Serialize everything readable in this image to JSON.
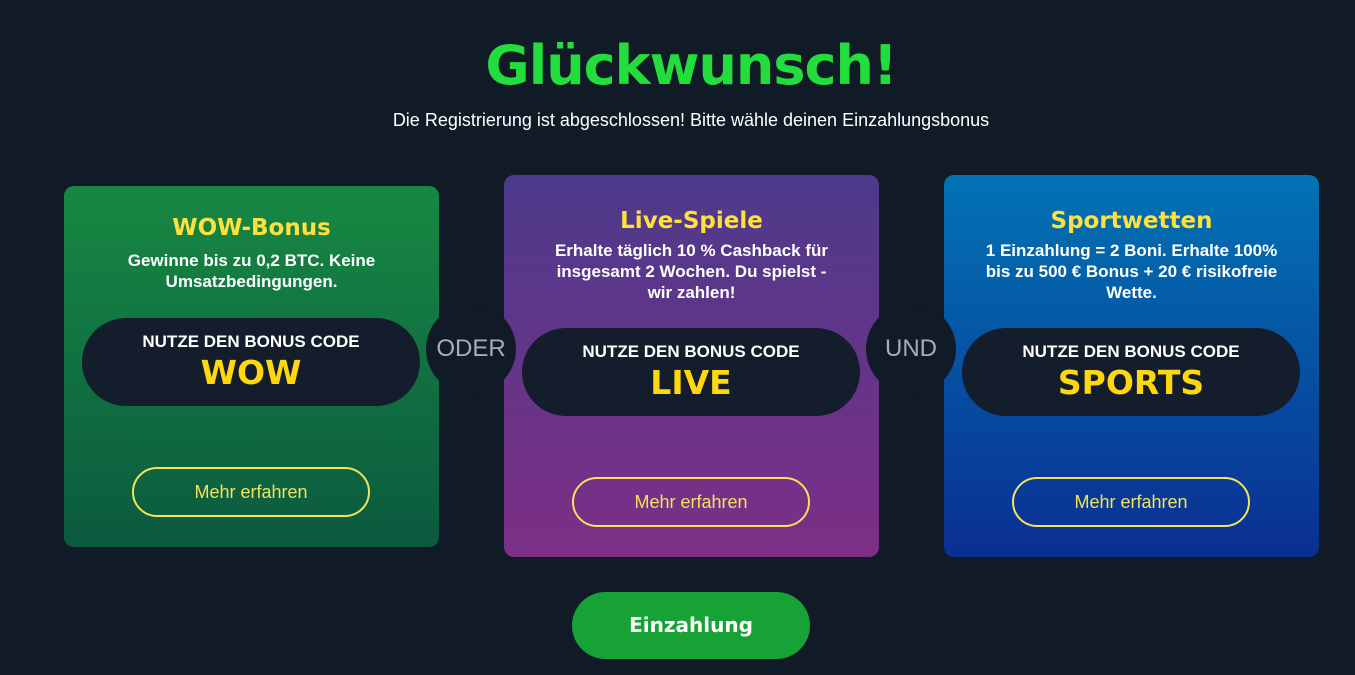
{
  "header": {
    "title": "Glückwunsch!",
    "subtitle": "Die Registrierung ist abgeschlossen! Bitte wähle deinen Einzahlungsbonus"
  },
  "cards": [
    {
      "title": "WOW-Bonus",
      "description": "Gewinne bis zu 0,2 BTC. Keine Umsatzbedingungen.",
      "code_label": "NUTZE DEN BONUS CODE",
      "code": "WOW",
      "button_label": "Mehr erfahren"
    },
    {
      "title": "Live-Spiele",
      "description": "Erhalte täglich 10 % Cashback für insgesamt 2 Wochen. Du spielst - wir zahlen!",
      "code_label": "NUTZE DEN BONUS CODE",
      "code": "LIVE",
      "button_label": "Mehr erfahren"
    },
    {
      "title": "Sportwetten",
      "description": "1 Einzahlung = 2 Boni. Erhalte 100% bis zu 500 € Bonus + 20 € risikofreie Wette.",
      "code_label": "NUTZE DEN BONUS CODE",
      "code": "SPORTS",
      "button_label": "Mehr erfahren"
    }
  ],
  "connectors": [
    "ODER",
    "UND"
  ],
  "deposit_button": "Einzahlung",
  "colors": {
    "background": "#111b27",
    "title": "#22dd3b",
    "card_title": "#ffe03d",
    "code": "#ffd70f",
    "button_outline": "#f4e35a",
    "deposit": "#17a236"
  }
}
